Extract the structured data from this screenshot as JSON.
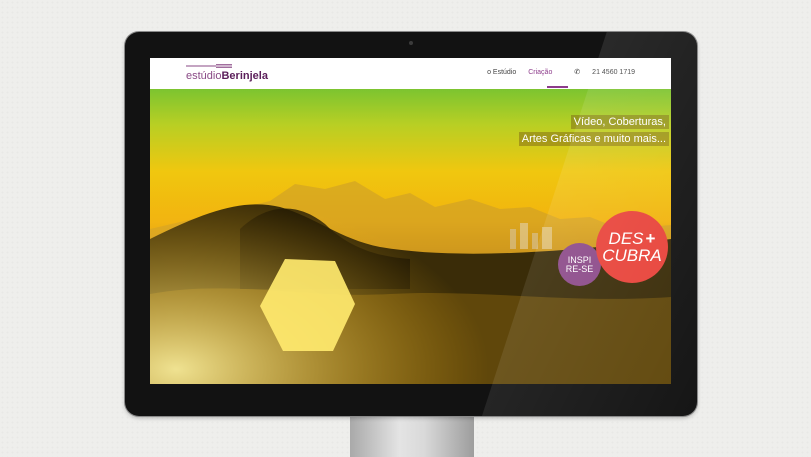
{
  "site": {
    "logo_light": "estúdio",
    "logo_bold": "Berinjela"
  },
  "nav": {
    "items": [
      "o Estúdio",
      "Criação"
    ],
    "phone": "21 4560 1719",
    "active_index": 1
  },
  "hero": {
    "taglines": [
      "Vídeo, Coberturas,",
      "Artes Gráficas e muito mais..."
    ],
    "inspire_line1": "INSPI",
    "inspire_line2": "RE-SE",
    "discover_line1": "DES",
    "discover_plus": "+",
    "discover_line2": "CUBRA"
  },
  "colors": {
    "brand_purple": "#5b1e5a",
    "nav_active": "#8d3c8b",
    "badge_red": "#e8433a",
    "badge_purple": "#8c4a89"
  },
  "icons": [
    "phone-icon"
  ]
}
